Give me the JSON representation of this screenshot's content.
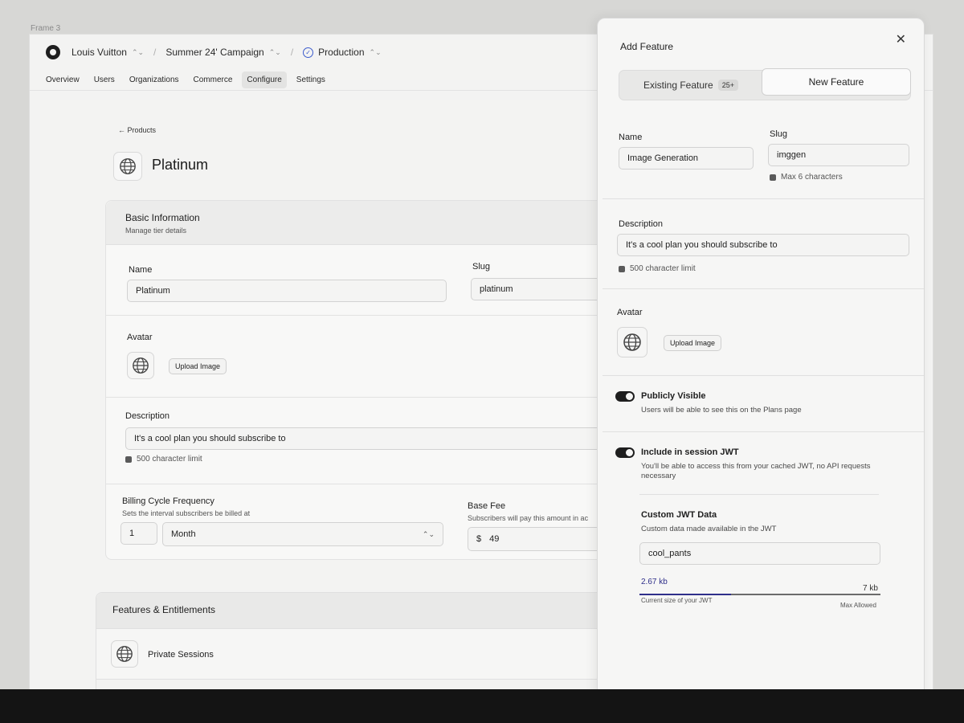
{
  "frame_label": "Frame 3",
  "topbar": {
    "org": "Louis Vuitton",
    "campaign": "Summer 24' Campaign",
    "environment": "Production"
  },
  "nav_tabs": [
    {
      "label": "Overview"
    },
    {
      "label": "Users"
    },
    {
      "label": "Organizations"
    },
    {
      "label": "Commerce"
    },
    {
      "label": "Configure",
      "active": true
    },
    {
      "label": "Settings"
    }
  ],
  "page": {
    "back_label": "Products",
    "title": "Platinum"
  },
  "basic_info": {
    "title": "Basic Information",
    "subtitle": "Manage tier details",
    "name_label": "Name",
    "name_value": "Platinum",
    "slug_label": "Slug",
    "slug_value": "platinum",
    "avatar_label": "Avatar",
    "upload_label": "Upload Image",
    "description_label": "Description",
    "description_value": "It's a cool plan you should subscribe to",
    "description_hint": "500 character limit",
    "billing_label": "Billing Cycle Frequency",
    "billing_sub": "Sets the interval subscribers be billed at",
    "billing_count": "1",
    "billing_unit": "Month",
    "base_fee_label": "Base Fee",
    "base_fee_sub": "Subscribers will pay this amount in ac",
    "currency": "$",
    "base_fee_value": "49"
  },
  "features": {
    "title": "Features & Entitlements",
    "items": [
      {
        "label": "Private Sessions"
      }
    ]
  },
  "panel": {
    "title": "Add Feature",
    "close_icon": "close-icon",
    "seg_existing": "Existing Feature",
    "seg_existing_badge": "25+",
    "seg_new": "New Feature",
    "name_label": "Name",
    "name_value": "Image Generation",
    "slug_label": "Slug",
    "slug_value": "imggen",
    "slug_hint": "Max 6 characters",
    "description_label": "Description",
    "description_value": "It's a cool plan you should subscribe to",
    "description_hint": "500 character limit",
    "avatar_label": "Avatar",
    "upload_label": "Upload Image",
    "public_title": "Publicly Visible",
    "public_sub": "Users will be able to see this on the Plans page",
    "public_on": true,
    "jwt_title": "Include in session JWT",
    "jwt_sub": "You'll be able to access this from your cached JWT, no API requests necessary",
    "jwt_on": true,
    "custom_title": "Custom JWT Data",
    "custom_sub": "Custom data made available in the JWT",
    "custom_value": "cool_pants",
    "jwt_size": "2.67 kb",
    "jwt_max": "7 kb",
    "jwt_size_caption": "Current size of your JWT",
    "jwt_max_caption": "Max Allowed",
    "jwt_fraction": 0.38
  }
}
